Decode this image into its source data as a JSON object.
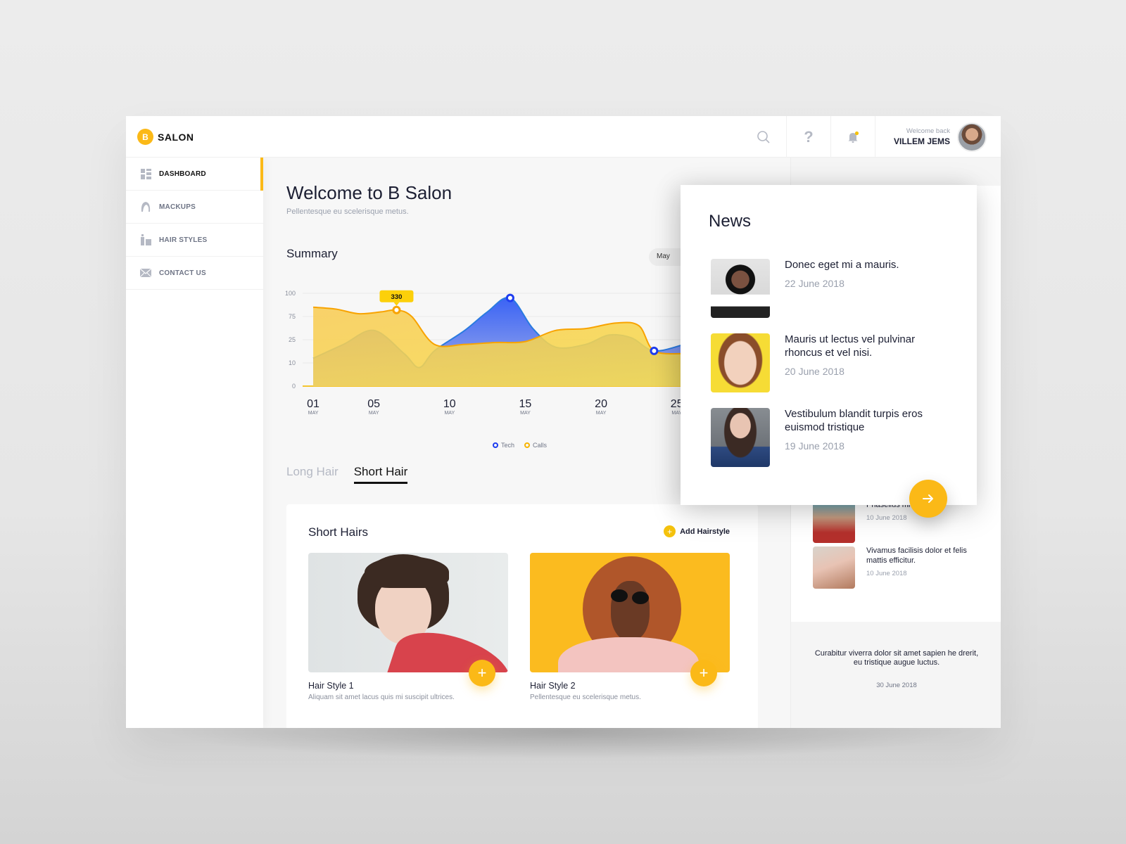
{
  "app": {
    "logo_letter": "B",
    "logo_text": "SALON",
    "accent": "#fbb917"
  },
  "topbar": {
    "icons": [
      "search-icon",
      "help-icon",
      "bell-icon"
    ],
    "welcome_text": "Welcome back",
    "user_name": "VILLEM JEMS"
  },
  "sidebar": {
    "items": [
      {
        "label": "DASHBOARD",
        "icon": "dashboard-icon",
        "active": true
      },
      {
        "label": "MACKUPS",
        "icon": "hair-icon",
        "active": false
      },
      {
        "label": "HAIR STYLES",
        "icon": "products-icon",
        "active": false
      },
      {
        "label": "CONTACT US",
        "icon": "mail-icon",
        "active": false
      }
    ]
  },
  "main": {
    "title": "Welcome to B Salon",
    "subtitle": "Pellentesque eu scelerisque metus.",
    "summary_title": "Summary",
    "month_select": "May",
    "tabs": [
      {
        "label": "Long Hair",
        "active": false
      },
      {
        "label": "Short Hair",
        "active": true
      }
    ],
    "styles_card": {
      "title": "Short Hairs",
      "add_label": "Add Hairstyle",
      "items": [
        {
          "name": "Hair Style 1",
          "desc": "Aliquam sit amet lacus quis mi suscipit ultrices."
        },
        {
          "name": "Hair Style 2",
          "desc": "Pellentesque eu scelerisque metus."
        }
      ]
    }
  },
  "chart_data": {
    "type": "area",
    "title": "Summary",
    "y_ticks": [
      "100",
      "75",
      "25",
      "10",
      "0"
    ],
    "x_ticks": [
      {
        "day": "01",
        "month": "MAY"
      },
      {
        "day": "05",
        "month": "MAY"
      },
      {
        "day": "10",
        "month": "MAY"
      },
      {
        "day": "15",
        "month": "MAY"
      },
      {
        "day": "20",
        "month": "MAY"
      },
      {
        "day": "25",
        "month": "MAY"
      }
    ],
    "ylim": [
      0,
      100
    ],
    "grid": true,
    "legend_position": "bottom",
    "series": [
      {
        "name": "Tech",
        "color": "#2f5bf0",
        "x": [
          1,
          3,
          5,
          7,
          8,
          9,
          11,
          12.5,
          14,
          15.5,
          17,
          19,
          20.5,
          22,
          23.5,
          25.5
        ],
        "values": [
          30,
          45,
          60,
          35,
          20,
          38,
          60,
          80,
          95,
          62,
          42,
          45,
          55,
          52,
          38,
          45
        ]
      },
      {
        "name": "Calls",
        "color": "#f8a300",
        "x": [
          1,
          2.5,
          4,
          5.5,
          6.5,
          7.5,
          9,
          11,
          13,
          15,
          17,
          19,
          21,
          22.5,
          23.5,
          25.5
        ],
        "values": [
          85,
          83,
          78,
          80,
          82,
          75,
          45,
          45,
          47,
          48,
          60,
          62,
          68,
          65,
          38,
          35
        ]
      }
    ],
    "annotation": {
      "series": "Calls",
      "x": 6.5,
      "label": "330"
    },
    "highlight_points": [
      {
        "series": "Tech",
        "x": 14,
        "value": 95
      },
      {
        "series": "Tech",
        "x": 23.5,
        "value": 38
      }
    ]
  },
  "news": {
    "title": "News",
    "items": [
      {
        "headline": "Donec eget mi a mauris.",
        "date": "22 June 2018"
      },
      {
        "headline": "Mauris ut lectus vel pulvinar rhoncus et vel nisi.",
        "date": "20 June 2018"
      },
      {
        "headline": "Vestibulum blandit turpis eros euismod tristique",
        "date": "19 June 2018"
      }
    ]
  },
  "right_panel": {
    "items": [
      {
        "headline": "Phasellus mi sagittis.",
        "date": "10 June 2018"
      },
      {
        "headline": "Vivamus facilisis dolor et felis mattis efficitur.",
        "date": "10 June 2018"
      }
    ],
    "quote": "Curabitur viverra dolor sit amet sapien he drerit, eu tristique augue luctus.",
    "quote_date": "30 June 2018"
  }
}
